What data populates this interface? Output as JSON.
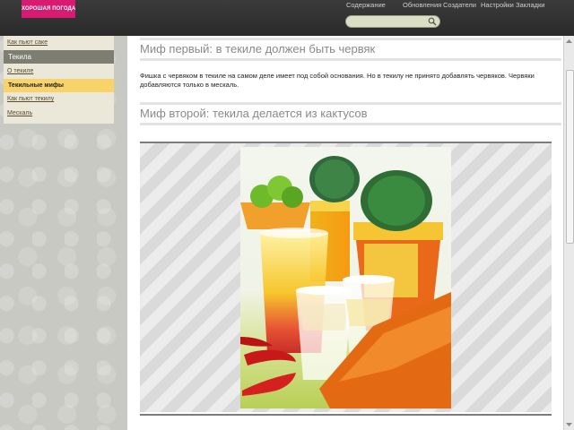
{
  "logo": {
    "text": "ХОРОШАЯ ПОГОДА."
  },
  "topnav": {
    "items": [
      "Содержание",
      "Обновления",
      "Создатели",
      "Настройки",
      "Закладки"
    ]
  },
  "search": {
    "placeholder": ""
  },
  "sidebar": {
    "link_top": "Как пьют саке",
    "section": "Текила",
    "items": [
      {
        "label": "О текиле",
        "active": false
      },
      {
        "label": "Текильные мифы",
        "active": true
      },
      {
        "label": "Как пьют текилу",
        "active": false
      },
      {
        "label": "Мескаль",
        "active": false
      }
    ]
  },
  "article": {
    "heading1": "Миф первый: в текиле должен быть червяк",
    "paragraph1": "Фишка с червяком в текиле на самом деле имеет под собой основания. Но в текилу не принято добавлять червяков. Червяки добавляются только в мескаль.",
    "heading2": "Миф второй: текила делается из кактусов"
  },
  "colors": {
    "logo": "#d81b72",
    "topbar": "#2f2f2f",
    "active_item": "#f7d36a",
    "section": "#7d7d72"
  },
  "icons": [
    "search-icon",
    "scroll-up-icon",
    "scroll-down-icon"
  ]
}
